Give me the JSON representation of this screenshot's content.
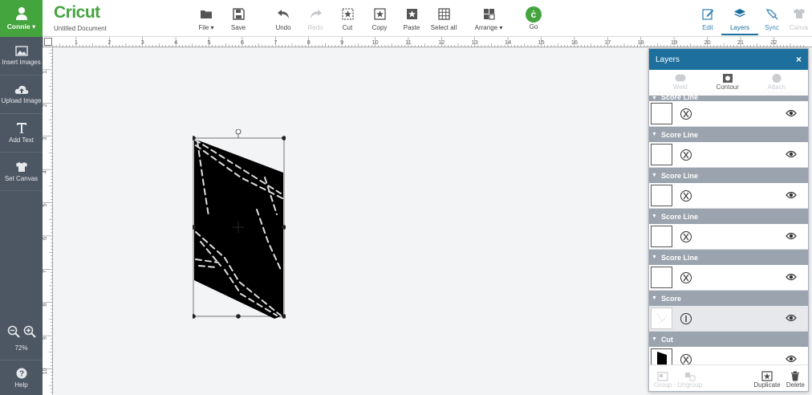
{
  "user": {
    "name": "Connie ▾"
  },
  "sidebar": {
    "items": [
      {
        "label": "Insert Images",
        "icon": "image-icon"
      },
      {
        "label": "Upload Image",
        "icon": "upload-icon"
      },
      {
        "label": "Add Text",
        "icon": "text-icon"
      },
      {
        "label": "Set Canvas",
        "icon": "shirt-icon"
      }
    ],
    "zoom_level": "72%",
    "help_label": "Help"
  },
  "header": {
    "logo": "Cricut",
    "document_title": "Untitled Document",
    "tools": {
      "file": "File ▾",
      "save": "Save",
      "undo": "Undo",
      "redo": "Redo",
      "cut": "Cut",
      "copy": "Copy",
      "paste": "Paste",
      "select_all": "Select all",
      "arrange": "Arrange ▾",
      "go": "Go"
    },
    "tabs": {
      "edit": "Edit",
      "layers": "Layers",
      "sync": "Sync",
      "canvas": "Canva"
    }
  },
  "ruler": {
    "top_numbers": [
      "1",
      "2",
      "3",
      "4",
      "5",
      "6",
      "7",
      "8",
      "9",
      "10",
      "11",
      "12",
      "13",
      "14",
      "15",
      "16",
      "17",
      "18",
      "19",
      "20",
      "21",
      "22"
    ],
    "left_numbers": [
      "1",
      "2",
      "3",
      "4",
      "5",
      "6",
      "7",
      "8",
      "9",
      "10"
    ]
  },
  "layers_panel": {
    "title": "Layers",
    "close": "×",
    "tools": {
      "weld": "Weld",
      "contour": "Contour",
      "attach": "Attach"
    },
    "partial_header": "Score Line",
    "groups": [
      {
        "header": "Score Line",
        "type": "score-line"
      },
      {
        "header": "Score Line",
        "type": "score-line"
      },
      {
        "header": "Score Line",
        "type": "score-line"
      },
      {
        "header": "Score Line",
        "type": "score-line"
      },
      {
        "header": "Score",
        "type": "score"
      },
      {
        "header": "Cut",
        "type": "cut"
      }
    ],
    "footer": {
      "group": "Group",
      "ungroup": "Ungroup",
      "duplicate": "Duplicate",
      "delete": "Delete"
    }
  },
  "colors": {
    "brand_green": "#44a43e",
    "sidebar": "#4d5663",
    "panel_header": "#1d6f9e",
    "group_header": "#9aa3ae"
  }
}
